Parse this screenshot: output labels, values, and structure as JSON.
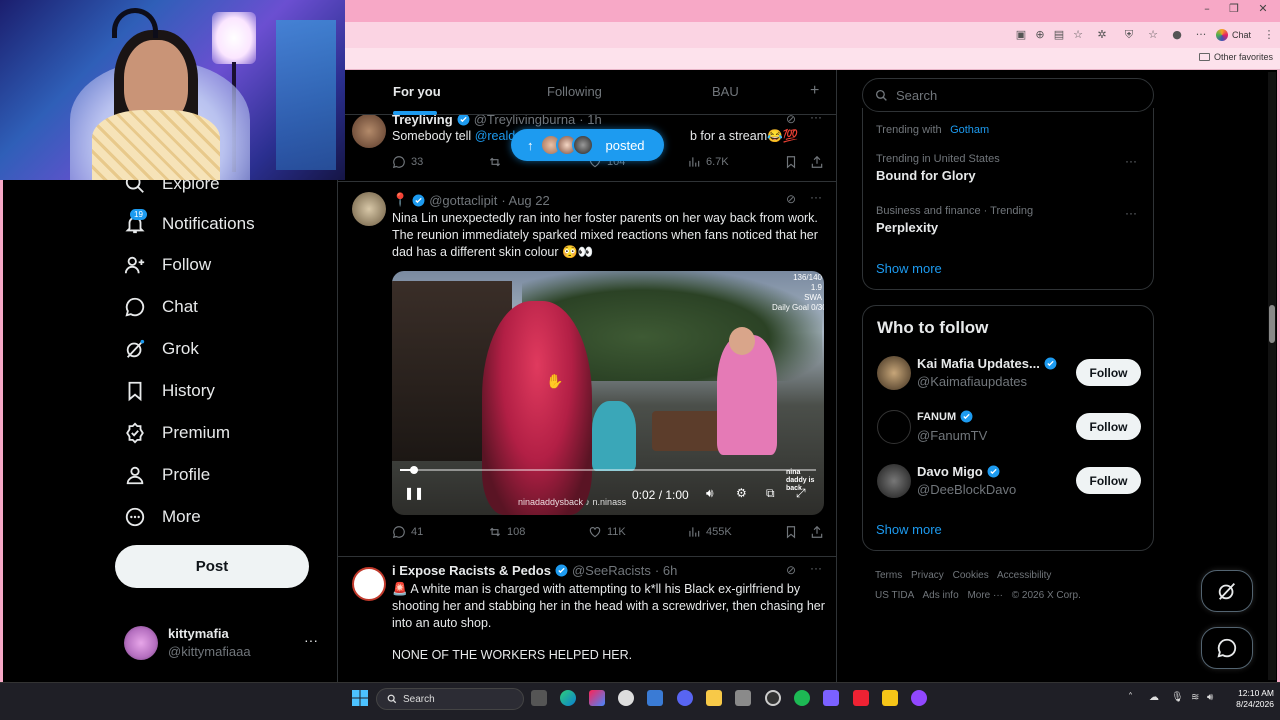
{
  "browser": {
    "window_controls": {
      "minimize": "–",
      "restore": "❐",
      "close": "✕"
    },
    "chat_label": "Chat",
    "other_favorites": "Other favorites"
  },
  "nav": {
    "explore": "Explore",
    "notifications": "Notifications",
    "notifications_badge": "19",
    "follow": "Follow",
    "chat": "Chat",
    "grok": "Grok",
    "history": "History",
    "premium": "Premium",
    "profile": "Profile",
    "more": "More",
    "post_button": "Post",
    "account": {
      "name": "kittymafia",
      "handle": "@kittymafiaaa",
      "more": "···"
    }
  },
  "timeline": {
    "tabs": [
      "For you",
      "Following",
      "BAU"
    ],
    "add_tab": "+",
    "posted_pill": {
      "arrow": "↑",
      "label": "posted"
    },
    "tweets": [
      {
        "name": "Treyliving",
        "handle": "@Treylivingburna",
        "time": "· 1h",
        "text_start": "Somebody tell",
        "text_mention": "@reald",
        "text_end": "b for a stream😂💯",
        "replies": "33",
        "likes": "104",
        "views": "6.7K"
      },
      {
        "name": "📍",
        "handle": "@gottaclipit",
        "time": "· Aug 22",
        "text": "Nina Lin unexpectedly ran into her foster parents on her way back from work. The reunion immediately sparked mixed reactions when fans noticed that her dad has a different skin colour 😳👀",
        "video": {
          "time": "0:02 / 1:00",
          "progress": 0.033,
          "overlay": "136/140\n1.9\nSWA\nDaily Goal 0/30",
          "watermark": "ninadaddysback  ♪ n.ninass",
          "corner": "nina daddy is back"
        },
        "replies": "41",
        "reposts": "108",
        "likes": "11K",
        "views": "455K"
      },
      {
        "name": "i Expose Racists & Pedos",
        "handle": "@SeeRacists",
        "time": "· 6h",
        "text": "🚨 A white man is charged with attempting to k*ll his Black ex-girlfriend by shooting her and stabbing her in the head with a screwdriver, then chasing her into an auto shop.",
        "text2": "NONE OF THE WORKERS HELPED HER."
      }
    ]
  },
  "sidebar": {
    "search_placeholder": "Search",
    "trends": [
      {
        "meta": "Trending with",
        "meta_link": "Gotham",
        "title": ""
      },
      {
        "meta": "Trending in United States",
        "title": "Bound for Glory"
      },
      {
        "meta": "Business and finance · Trending",
        "title": "Perplexity"
      }
    ],
    "trends_show_more": "Show more",
    "who_to_follow_title": "Who to follow",
    "who_to_follow": [
      {
        "name": "Kai Mafia Updates...",
        "handle": "@Kaimafiaupdates",
        "button": "Follow"
      },
      {
        "name": "FANUM",
        "handle": "@FanumTV",
        "button": "Follow"
      },
      {
        "name": "Davo Migo",
        "handle": "@DeeBlockDavo",
        "button": "Follow"
      }
    ],
    "wtf_show_more": "Show more",
    "footer": [
      "Terms",
      "Privacy",
      "Cookies",
      "Accessibility",
      "US TIDA",
      "Ads info",
      "More ···",
      "© 2026 X Corp."
    ]
  },
  "taskbar": {
    "search_label": "Search",
    "time": "12:10 AM",
    "date": "8/24/2026"
  },
  "colors": {
    "accent": "#1d9bf0",
    "browser_frame": "#f7a8c6",
    "background": "#000000"
  }
}
